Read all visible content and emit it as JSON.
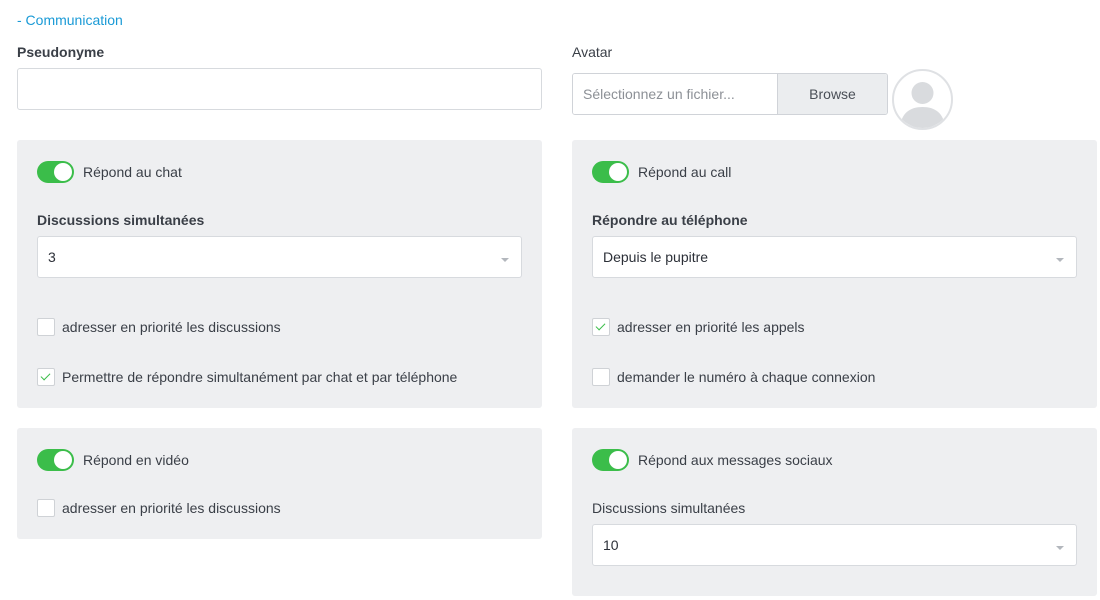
{
  "section": {
    "label": "- Communication"
  },
  "pseudonyme": {
    "label": "Pseudonyme",
    "value": "",
    "placeholder": ""
  },
  "avatar": {
    "label": "Avatar",
    "placeholder": "Sélectionnez un fichier...",
    "browse_label": "Browse",
    "icon": "user-silhouette-icon"
  },
  "chat_panel": {
    "toggle_label": "Répond au chat",
    "toggle_on": true,
    "select_label": "Discussions simultanées",
    "select_value": "3",
    "checkboxes": [
      {
        "label": "adresser en priorité les discussions",
        "checked": false
      },
      {
        "label": "Permettre de répondre simultanément par chat et par téléphone",
        "checked": true
      }
    ]
  },
  "call_panel": {
    "toggle_label": "Répond au call",
    "toggle_on": true,
    "select_label": "Répondre au téléphone",
    "select_value": "Depuis le pupitre",
    "checkboxes": [
      {
        "label": "adresser en priorité les appels",
        "checked": true
      },
      {
        "label": "demander le numéro à chaque connexion",
        "checked": false
      }
    ]
  },
  "video_panel": {
    "toggle_label": "Répond en vidéo",
    "toggle_on": true,
    "checkboxes": [
      {
        "label": "adresser en priorité les discussions",
        "checked": false
      }
    ]
  },
  "social_panel": {
    "toggle_label": "Répond aux messages sociaux",
    "toggle_on": true,
    "select_label": "Discussions simultanées",
    "select_value": "10"
  },
  "colors": {
    "accent_link": "#1a9ad6",
    "toggle_on": "#3bbd4a",
    "panel_bg": "#eeeff1"
  }
}
